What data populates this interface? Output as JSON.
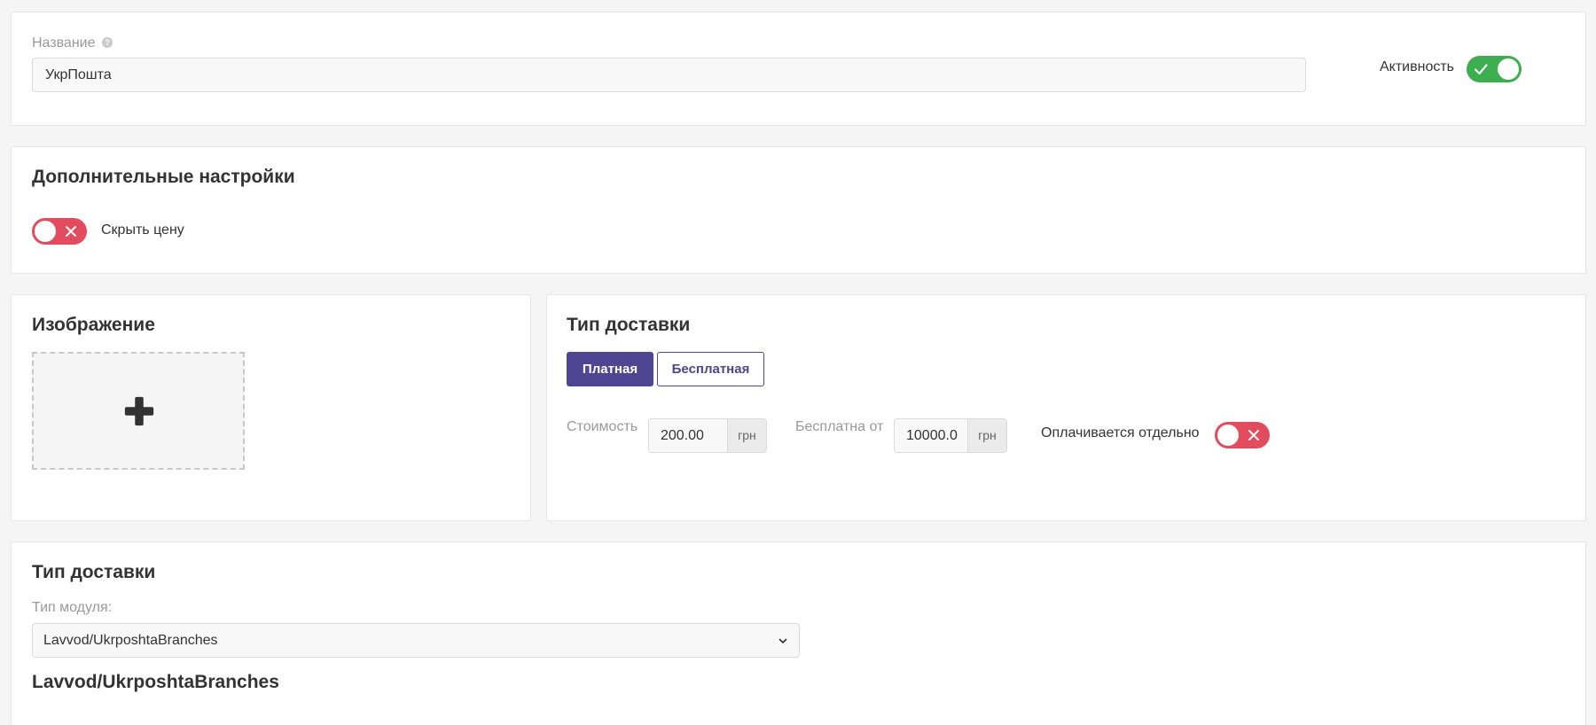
{
  "general": {
    "name_label": "Название",
    "name_value": "УкрПошта",
    "activity_label": "Активность",
    "activity_on": true
  },
  "additional": {
    "title": "Дополнительные настройки",
    "hide_price_label": "Скрыть цену",
    "hide_price_on": false
  },
  "image": {
    "title": "Изображение"
  },
  "delivery_type": {
    "title": "Тип доставки",
    "paid_label": "Платная",
    "free_label": "Бесплатная",
    "cost_label": "Стоимость",
    "cost_value": "200.00",
    "cost_currency": "грн",
    "free_from_label": "Бесплатна от",
    "free_from_value": "10000.0",
    "free_from_currency": "грн",
    "separate_label": "Оплачивается отдельно",
    "separate_on": false
  },
  "module": {
    "title": "Тип доставки",
    "module_type_label": "Тип модуля:",
    "module_value": "Lavvod/UkrposhtaBranches",
    "subtitle": "Lavvod/UkrposhtaBranches"
  },
  "colors": {
    "primary": "#4e4593",
    "toggle_on": "#3cae4f",
    "toggle_off": "#e34b5f"
  }
}
